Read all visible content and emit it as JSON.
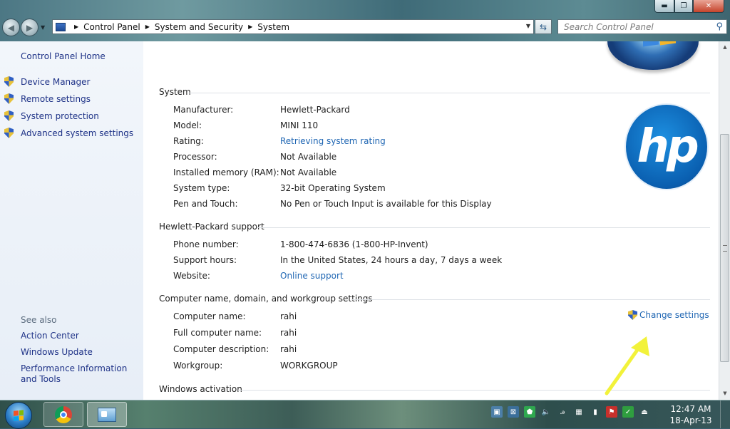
{
  "window": {
    "controls": {
      "minimize": "▬",
      "maximize": "❐",
      "close": "✕"
    }
  },
  "address": {
    "crumbs": [
      "Control Panel",
      "System and Security",
      "System"
    ],
    "search_placeholder": "Search Control Panel"
  },
  "left_pane": {
    "home_link": "Control Panel Home",
    "tasks": [
      "Device Manager",
      "Remote settings",
      "System protection",
      "Advanced system settings"
    ],
    "see_also_title": "See also",
    "see_also": [
      "Action Center",
      "Windows Update",
      "Performance Information and Tools"
    ]
  },
  "system": {
    "title": "System",
    "rows": [
      {
        "label": "Manufacturer:",
        "value": "Hewlett-Packard"
      },
      {
        "label": "Model:",
        "value": "MINI 110"
      },
      {
        "label": "Rating:",
        "value": "Retrieving system rating"
      },
      {
        "label": "Processor:",
        "value": "Not Available"
      },
      {
        "label": "Installed memory (RAM):",
        "value": "Not Available"
      },
      {
        "label": "System type:",
        "value": "32-bit Operating System"
      },
      {
        "label": "Pen and Touch:",
        "value": "No Pen or Touch Input is available for this Display"
      }
    ],
    "oem_logo_text": "hp"
  },
  "support": {
    "title": "Hewlett-Packard support",
    "rows": [
      {
        "label": "Phone number:",
        "value": "1-800-474-6836 (1-800-HP-Invent)"
      },
      {
        "label": "Support hours:",
        "value": "In the United States, 24 hours a day, 7 days a week"
      },
      {
        "label": "Website:",
        "value": "Online support"
      }
    ]
  },
  "computer_name": {
    "title": "Computer name, domain, and workgroup settings",
    "change_settings": "Change settings",
    "rows": [
      {
        "label": "Computer name:",
        "value": "rahi"
      },
      {
        "label": "Full computer name:",
        "value": "rahi"
      },
      {
        "label": "Computer description:",
        "value": "rahi"
      },
      {
        "label": "Workgroup:",
        "value": "WORKGROUP"
      }
    ]
  },
  "activation": {
    "title": "Windows activation"
  },
  "taskbar": {
    "clock_time": "12:47 AM",
    "clock_date": "18-Apr-13"
  },
  "colors": {
    "link": "#1f66b3",
    "nav_link": "#1e3287",
    "annotation_arrow": "#f2f23a"
  }
}
